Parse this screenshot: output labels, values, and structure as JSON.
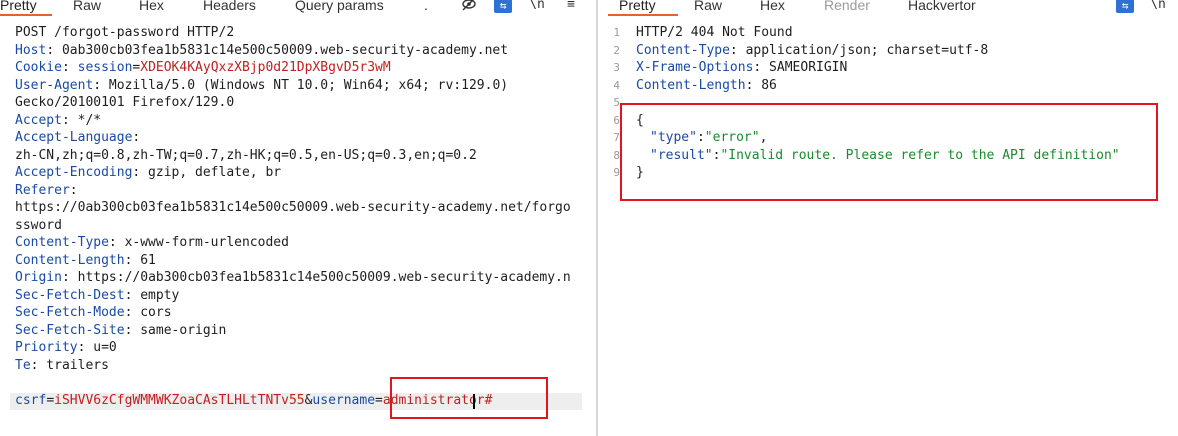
{
  "left": {
    "tabs": [
      "Pretty",
      "Raw",
      "Hex",
      "Headers",
      "Query params",
      "."
    ],
    "toolbar": {
      "hide_icon": "eye-slash-icon",
      "wrap_icon": "wrap-icon",
      "newline": "\\n",
      "menu_icon": "hamburger-menu-icon"
    },
    "request_line": "POST /forgot-password HTTP/2",
    "headers": [
      {
        "name": "Host",
        "value": " 0ab300cb03fea1b5831c14e500c50009.web-security-academy.net"
      },
      {
        "name": "Cookie",
        "value": " ",
        "cookie_name": "session",
        "cookie_value": "XDEOK4KAyQxzXBjp0d21DpXBgvD5r3wM"
      },
      {
        "name": "User-Agent",
        "value": " Mozilla/5.0 (Windows NT 10.0; Win64; x64; rv:129.0)"
      },
      {
        "continuation": "Gecko/20100101 Firefox/129.0"
      },
      {
        "name": "Accept",
        "value": " */*"
      },
      {
        "name": "Accept-Language",
        "value": ""
      },
      {
        "continuation": "zh-CN,zh;q=0.8,zh-TW;q=0.7,zh-HK;q=0.5,en-US;q=0.3,en;q=0.2"
      },
      {
        "name": "Accept-Encoding",
        "value": " gzip, deflate, br"
      },
      {
        "name": "Referer",
        "value": ""
      },
      {
        "continuation": "https://0ab300cb03fea1b5831c14e500c50009.web-security-academy.net/forgo"
      },
      {
        "continuation": "ssword"
      },
      {
        "name": "Content-Type",
        "value": " x-www-form-urlencoded"
      },
      {
        "name": "Content-Length",
        "value": " 61"
      },
      {
        "name": "Origin",
        "value": " https://0ab300cb03fea1b5831c14e500c50009.web-security-academy.n"
      },
      {
        "name": "Sec-Fetch-Dest",
        "value": " empty"
      },
      {
        "name": "Sec-Fetch-Mode",
        "value": " cors"
      },
      {
        "name": "Sec-Fetch-Site",
        "value": " same-origin"
      },
      {
        "name": "Priority",
        "value": " u=0"
      },
      {
        "name": "Te",
        "value": " trailers"
      }
    ],
    "body": {
      "param1_name": "csrf",
      "eq": "=",
      "param1_value": "iSHVV6zCfgWMMWKZoaCAsTLHLtTNTv55",
      "amp": "&",
      "param2_name": "username",
      "param2_value": "administrator#"
    }
  },
  "right": {
    "tabs": [
      "Pretty",
      "Raw",
      "Hex",
      "Render",
      "Hackvertor"
    ],
    "toolbar": {
      "wrap_icon": "wrap-icon",
      "newline": "\\n"
    },
    "line_numbers": [
      "1",
      "2",
      "3",
      "4",
      "5",
      "6",
      "7",
      "8",
      "9"
    ],
    "status_line": "HTTP/2 404 Not Found",
    "headers": [
      {
        "name": "Content-Type",
        "value": " application/json; charset=utf-8"
      },
      {
        "name": "X-Frame-Options",
        "value": " SAMEORIGIN"
      },
      {
        "name": "Content-Length",
        "value": " 86"
      }
    ],
    "json": {
      "open": "{",
      "k1": "\"type\"",
      "colon": ":",
      "v1": "\"error\"",
      "comma": ",",
      "k2": "\"result\"",
      "v2": "\"Invalid route. Please refer to the API definition\"",
      "close": "}"
    }
  },
  "colors": {
    "accent": "#e8632b",
    "header_name": "#1a4aa6",
    "cookie_value": "#c21f1f",
    "json_string": "#1d8a2e",
    "highlight_box": "#e0161f"
  }
}
